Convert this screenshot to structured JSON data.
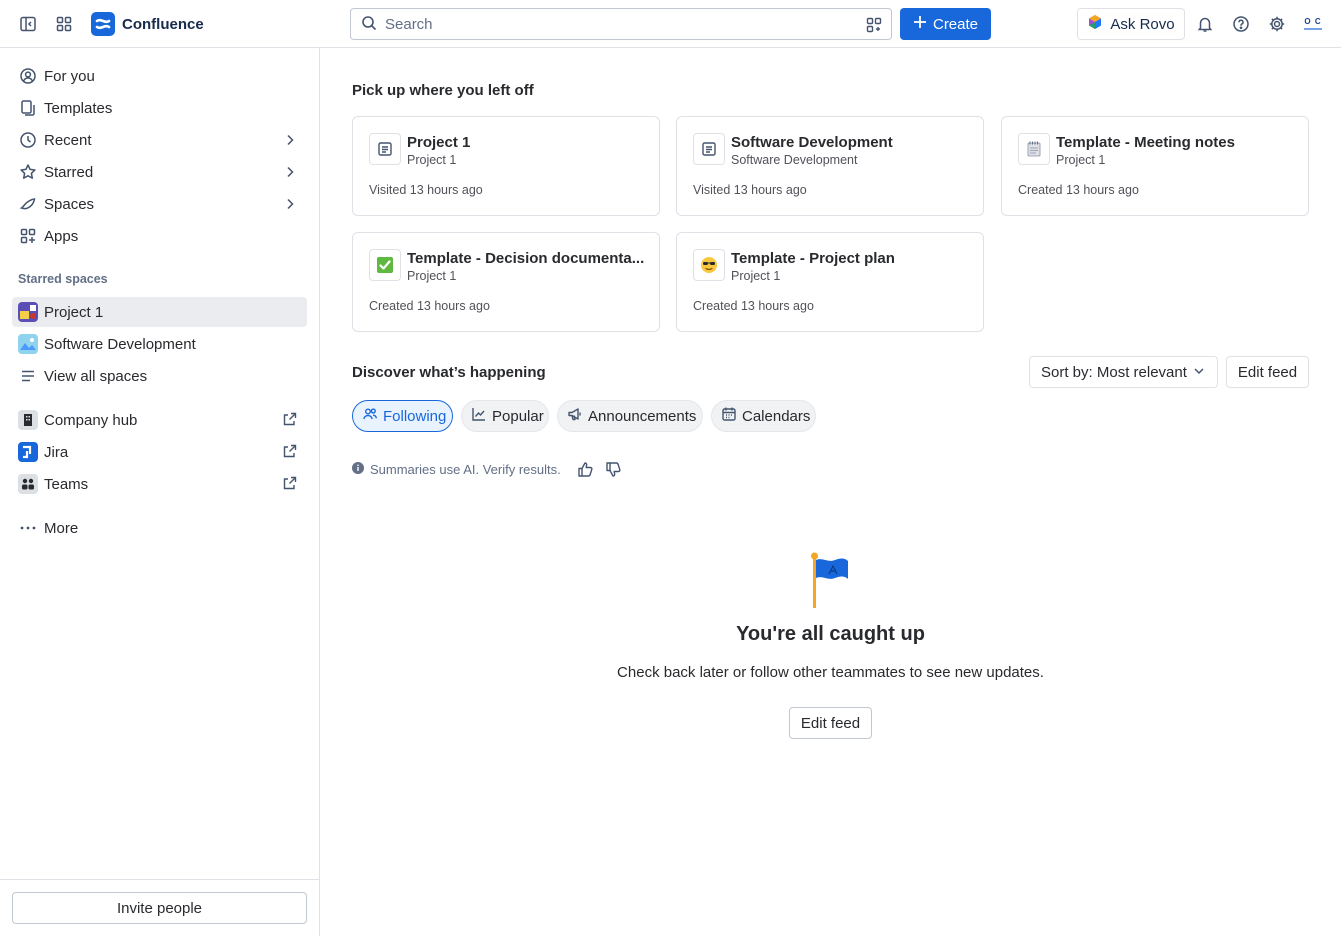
{
  "topbar": {
    "sidebar_toggle_icon": "sidebar-toggle-icon",
    "app_switcher_icon": "app-switcher-icon",
    "app_name": "Confluence",
    "search_placeholder": "Search",
    "create_label": "Create",
    "ask_rovo_label": "Ask Rovo",
    "avatar_initials_top": "O C",
    "colors": {
      "brand": "#1868db"
    }
  },
  "sidebar": {
    "nav": [
      {
        "label": "For you",
        "icon": "user-circle-icon"
      },
      {
        "label": "Templates",
        "icon": "templates-icon"
      },
      {
        "label": "Recent",
        "icon": "clock-icon"
      },
      {
        "label": "Starred",
        "icon": "star-icon"
      },
      {
        "label": "Spaces",
        "icon": "spaces-icon"
      },
      {
        "label": "Apps",
        "icon": "apps-icon"
      }
    ],
    "starred_spaces_label": "Starred spaces",
    "starred_spaces": [
      {
        "label": "Project 1"
      },
      {
        "label": "Software Development"
      },
      {
        "label": "View all spaces"
      }
    ],
    "external": [
      {
        "label": "Company hub"
      },
      {
        "label": "Jira"
      },
      {
        "label": "Teams"
      }
    ],
    "more_label": "More",
    "invite_label": "Invite people"
  },
  "main": {
    "recent_heading": "Pick up where you left off",
    "cards": [
      {
        "title": "Project 1",
        "subtitle": "Project 1",
        "meta": "Visited 13 hours ago",
        "icon": "page-icon"
      },
      {
        "title": "Software Development",
        "subtitle": "Software Development",
        "meta": "Visited 13 hours ago",
        "icon": "page-icon"
      },
      {
        "title": "Template - Meeting notes",
        "subtitle": "Project 1",
        "meta": "Created 13 hours ago",
        "icon": "notepad-icon"
      },
      {
        "title": "Template - Decision documenta...",
        "subtitle": "Project 1",
        "meta": "Created 13 hours ago",
        "icon": "checkmark-emoji-icon"
      },
      {
        "title": "Template - Project plan",
        "subtitle": "Project 1",
        "meta": "Created 13 hours ago",
        "icon": "sunglasses-emoji-icon"
      }
    ],
    "discover_heading": "Discover what’s happening",
    "sort_label": "Sort by: Most relevant",
    "edit_feed_label": "Edit feed",
    "tabs": [
      {
        "label": "Following",
        "selected": true
      },
      {
        "label": "Popular",
        "selected": false
      },
      {
        "label": "Announcements",
        "selected": false
      },
      {
        "label": "Calendars",
        "selected": false
      }
    ],
    "ai_note": "Summaries use AI. Verify results.",
    "empty_title": "You're all caught up",
    "empty_subtitle": "Check back later or follow other teammates to see new updates.",
    "empty_button": "Edit feed"
  }
}
